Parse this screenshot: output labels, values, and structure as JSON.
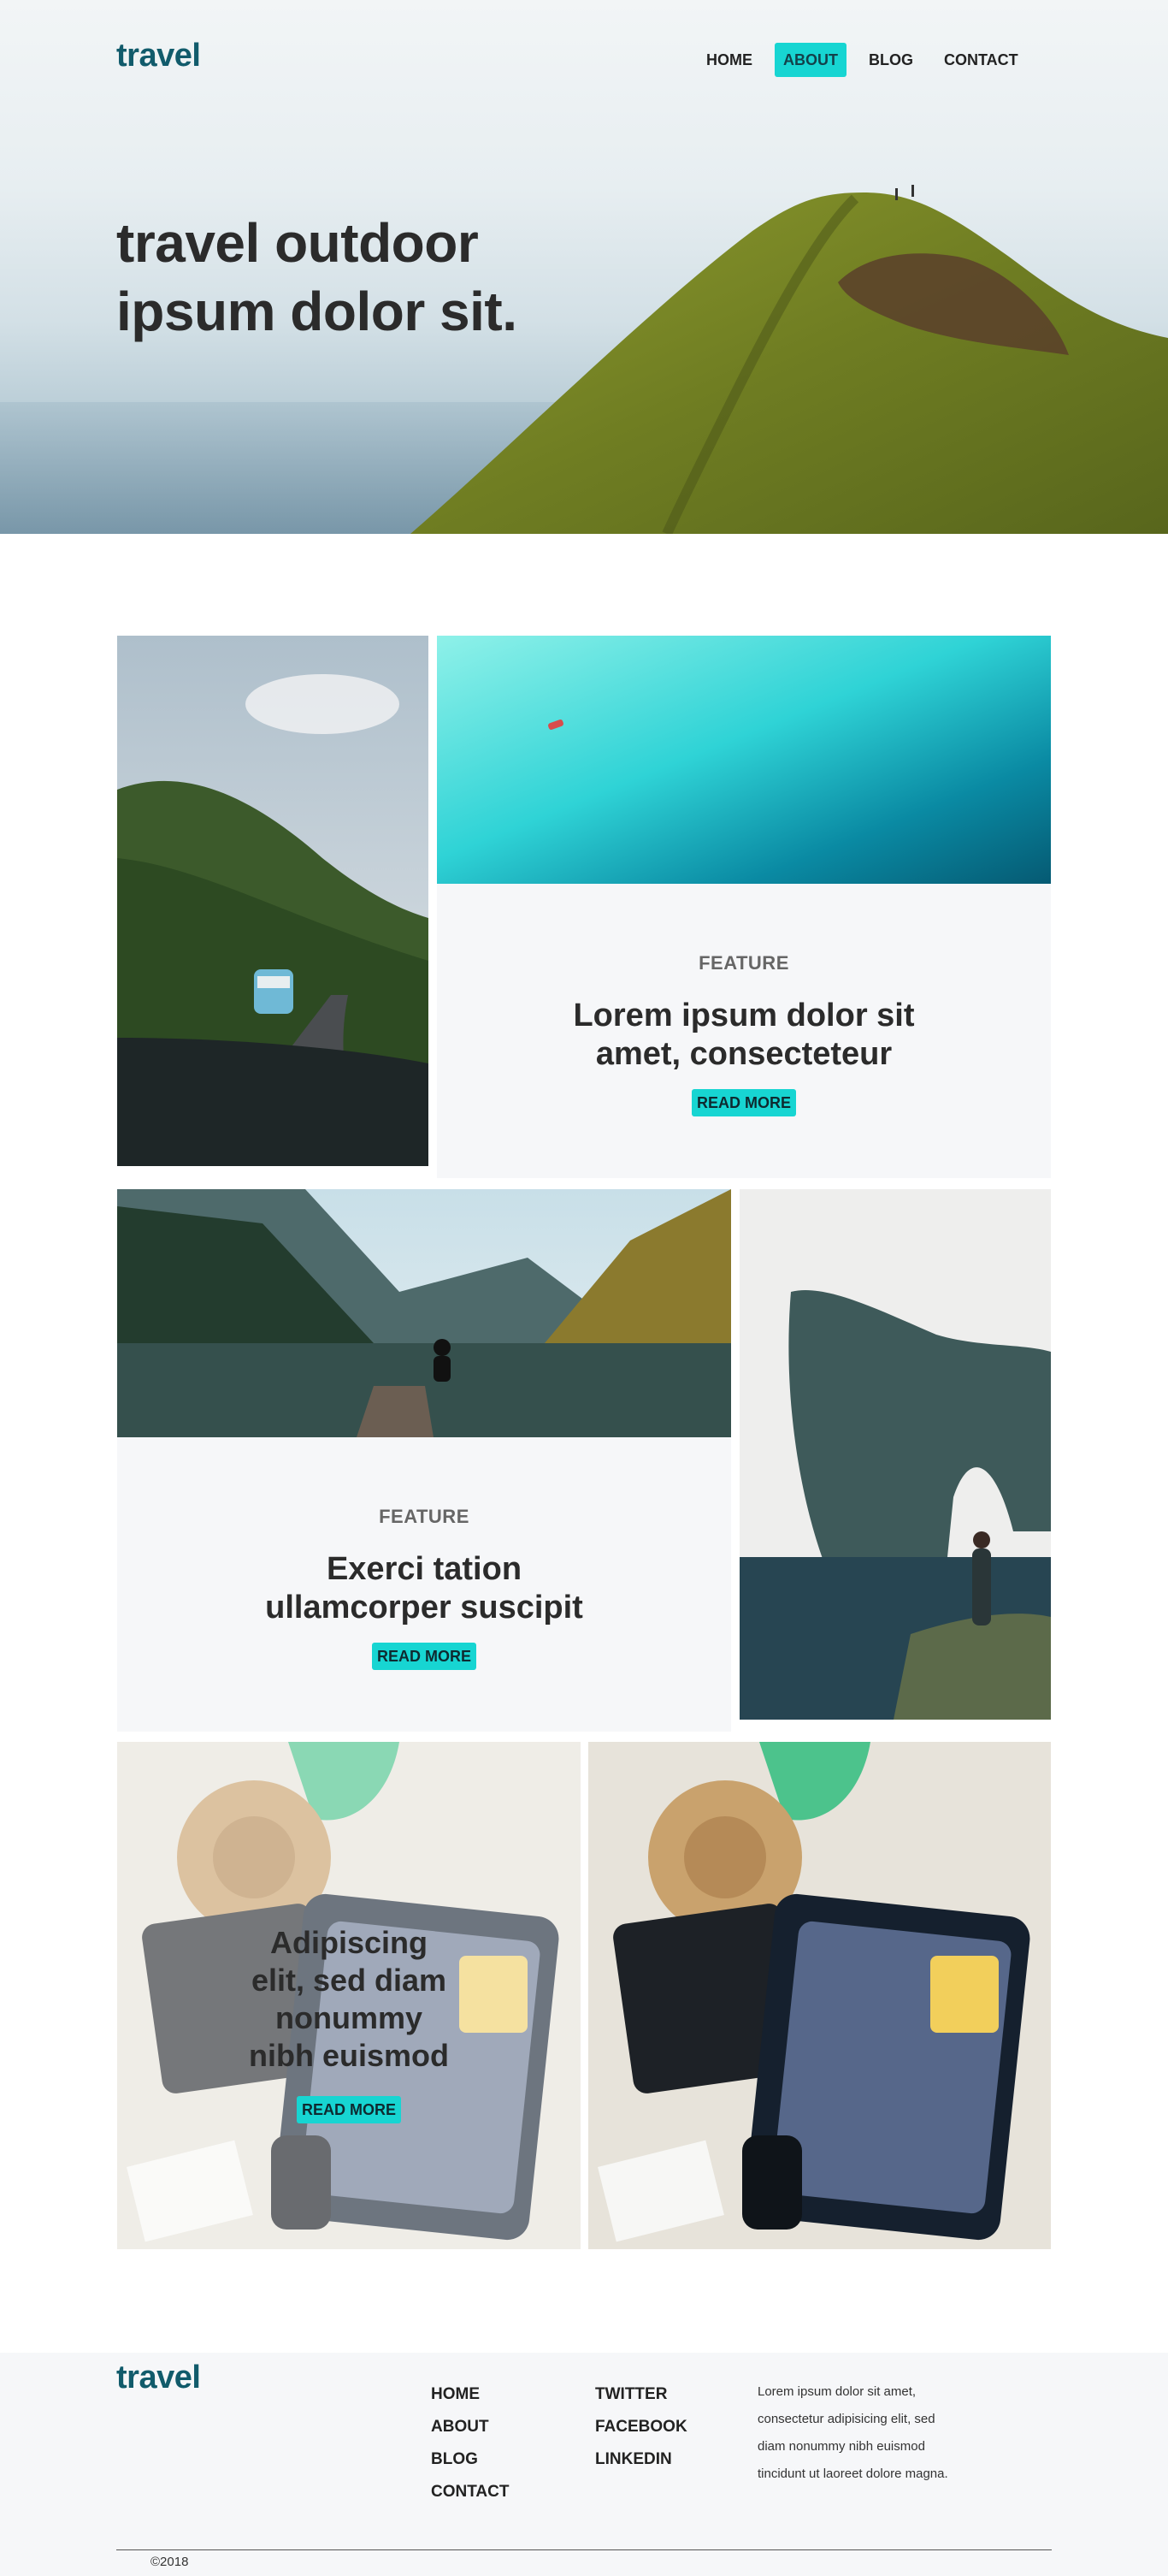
{
  "header": {
    "logo": "travel",
    "nav": [
      "HOME",
      "ABOUT",
      "BLOG",
      "CONTACT"
    ],
    "active_nav": "ABOUT"
  },
  "hero": {
    "title_line1": "travel outdoor",
    "title_line2": "ipsum dolor sit."
  },
  "features": [
    {
      "label": "FEATURE",
      "title_line1": "Lorem ipsum dolor sit",
      "title_line2": "amet, consecteteur",
      "button": "READ MORE"
    },
    {
      "label": "FEATURE",
      "title_line1": "Exerci tation",
      "title_line2": "ullamcorper suscipit",
      "button": "READ MORE"
    },
    {
      "title_lines": [
        "Adipiscing",
        "elit, sed diam",
        "nonummy",
        "nibh euismod"
      ],
      "button": "READ MORE"
    }
  ],
  "footer": {
    "logo": "travel",
    "col1": [
      "HOME",
      "ABOUT",
      "BLOG",
      "CONTACT"
    ],
    "col2": [
      "TWITTER",
      "FACEBOOK",
      "LINKEDIN"
    ],
    "about_lines": [
      "Lorem ipsum dolor sit amet,",
      "consectetur adipisicing elit, sed",
      "diam nonummy nibh euismod",
      "tincidunt ut laoreet dolore magna."
    ],
    "copyright": "©2018"
  },
  "colors": {
    "accent": "#17d5d2",
    "logo": "#115b6b",
    "panel": "#f6f7f9",
    "text": "#2b2b2b"
  },
  "icons": {
    "images": [
      "mountain-hill-photo",
      "road-van-photo",
      "ocean-kayak-photo",
      "lake-pier-photo",
      "sea-arch-photo",
      "suitcase-flatlay-photo"
    ]
  }
}
